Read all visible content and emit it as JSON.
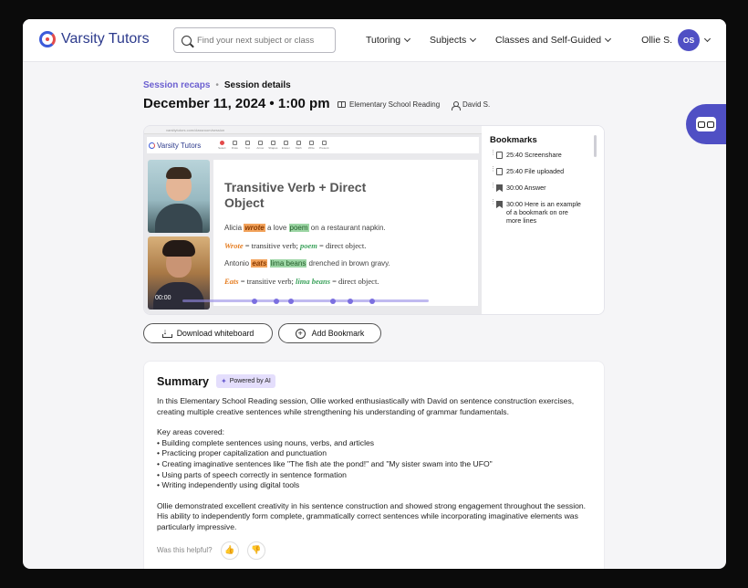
{
  "nav": {
    "logo": "Varsity Tutors",
    "search_placeholder": "Find your next subject or class",
    "menu": [
      {
        "label": "Tutoring"
      },
      {
        "label": "Subjects"
      },
      {
        "label": "Classes and Self-Guided"
      }
    ],
    "user_name": "Ollie S.",
    "user_initials": "OS"
  },
  "breadcrumb": {
    "parent": "Session recaps",
    "separator": "•",
    "current": "Session details"
  },
  "session": {
    "title": "December 11, 2024 • 1:00 pm",
    "subject": "Elementary School Reading",
    "tutor": "David S."
  },
  "video": {
    "url": "varsitytutors.com/classroom/session",
    "app_logo": "Varsity Tutors",
    "tools": [
      "Select",
      "Draw",
      "Text",
      "Arrow",
      "Shapes",
      "Eraser",
      "Math",
      "Write",
      "Present"
    ],
    "whiteboard_title": "Transitive Verb + Direct Object",
    "s1_pre": "Alicia",
    "s1_verb": "wrote",
    "s1_mid": "a love",
    "s1_obj": "poem",
    "s1_post": "on a restaurant napkin.",
    "d1_verb": "Wrote",
    "d1_mid": "= transitive verb;",
    "d1_obj": "poem",
    "d1_post": "= direct object.",
    "s2_pre": "Antonio",
    "s2_verb": "eats",
    "s2_obj": "lima beans",
    "s2_post": "drenched in brown gravy.",
    "d2_verb": "Eats",
    "d2_mid": "= transitive verb;",
    "d2_obj": "lima beans",
    "d2_post": "= direct object.",
    "time": "00:00",
    "bookmark_markers": [
      0.28,
      0.37,
      0.43,
      0.6,
      0.67,
      0.76
    ]
  },
  "bookmarks": {
    "title": "Bookmarks",
    "items": [
      {
        "time": "25:40",
        "text": "Screenshare",
        "icon": "screen-icon"
      },
      {
        "time": "25:40",
        "text": "File uploaded",
        "icon": "file-icon"
      },
      {
        "time": "30:00",
        "text": "Answer",
        "icon": "bookmark-icon"
      },
      {
        "time": "30:00",
        "text": "Here is an example of a bookmark on ore more lines",
        "icon": "bookmark-icon"
      }
    ]
  },
  "actions": {
    "download": "Download whiteboard",
    "add_bookmark": "Add Bookmark"
  },
  "summary": {
    "title": "Summary",
    "badge": "Powered by AI",
    "intro": "In this Elementary School Reading session, Ollie worked enthusiastically with David on sentence construction exercises, creating multiple creative sentences while strengthening his understanding of grammar fundamentals.",
    "areas_label": "Key areas covered:",
    "areas": [
      "Building complete sentences using nouns, verbs, and articles",
      "Practicing proper capitalization and punctuation",
      "Creating imaginative sentences like \"The fish ate the pond!\" and \"My sister swam into the UFO\"",
      "Using parts of speech correctly in sentence formation",
      "Writing independently using digital tools"
    ],
    "closing": "Ollie demonstrated excellent creativity in his sentence construction and showed strong engagement throughout the session. His ability to independently form complete, grammatically correct sentences while incorporating imaginative elements was particularly impressive.",
    "helpful": "Was this helpful?"
  }
}
